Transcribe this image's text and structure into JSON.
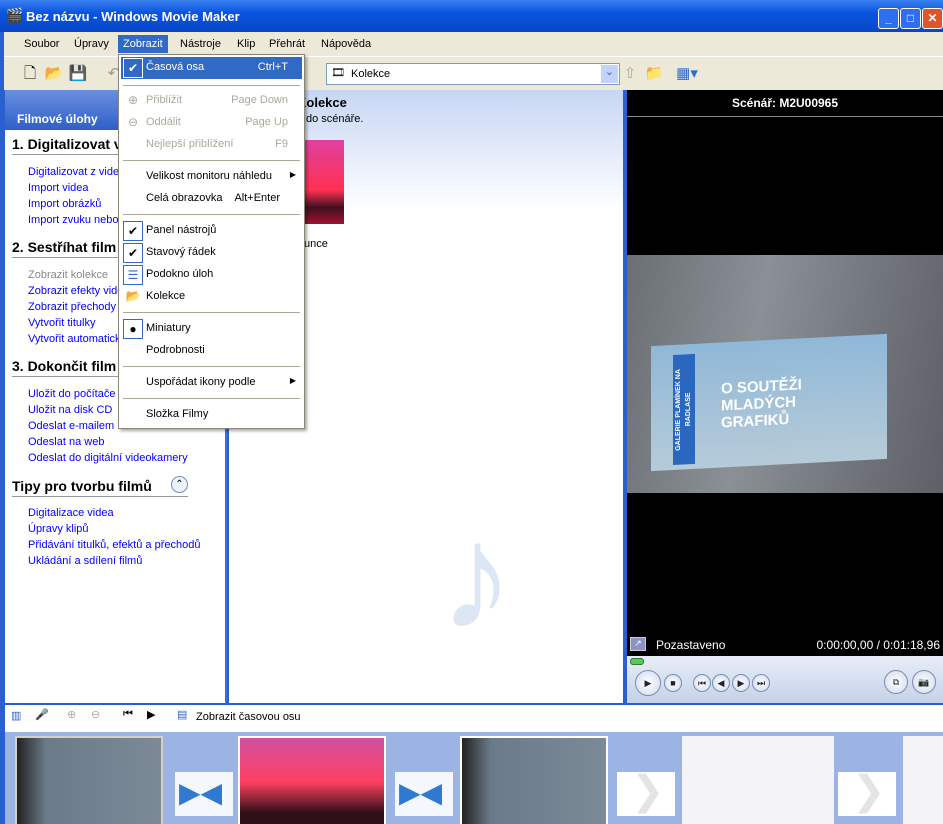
{
  "window": {
    "title": "Bez názvu - Windows Movie Maker",
    "buttons": {
      "minimize": "_",
      "maximize": "□",
      "close": "✕"
    }
  },
  "menubar": [
    "Soubor",
    "Úpravy",
    "Zobrazit",
    "Nástroje",
    "Klip",
    "Přehrát",
    "Nápověda"
  ],
  "toolbar": {
    "collection_combo": "Kolekce"
  },
  "view_menu": {
    "items": [
      {
        "label": "Časová osa",
        "shortcut": "Ctrl+T",
        "checked": true
      },
      {
        "label": "Přiblížit",
        "shortcut": "Page Down",
        "disabled": true
      },
      {
        "label": "Oddálit",
        "shortcut": "Page Up",
        "disabled": true
      },
      {
        "label": "Nejlepší přiblížení",
        "shortcut": "F9",
        "disabled": true
      },
      {
        "label": "Velikost monitoru náhledu",
        "submenu": true
      },
      {
        "label": "Celá obrazovka",
        "shortcut": "Alt+Enter"
      },
      {
        "label": "Panel nástrojů",
        "checked": true
      },
      {
        "label": "Stavový řádek",
        "checked": true
      },
      {
        "label": "Podokno úloh",
        "checked": true
      },
      {
        "label": "Kolekce"
      },
      {
        "label": "Miniatury",
        "selected": true
      },
      {
        "label": "Podrobnosti"
      },
      {
        "label": "Uspořádat ikony podle",
        "submenu": true
      },
      {
        "label": "Složka Filmy"
      }
    ]
  },
  "tasks": {
    "header": "Filmové úlohy",
    "sections": [
      {
        "title": "1. Digitalizovat video",
        "links": [
          "Digitalizovat z videokamery",
          "Import videa",
          "Import obrázků",
          "Import zvuku nebo hudby"
        ]
      },
      {
        "title": "2. Sestříhat film",
        "links": [
          "Zobrazit kolekce",
          "Zobrazit efekty videa",
          "Zobrazit přechody",
          "Vytvořit titulky",
          "Vytvořit automaticky film"
        ]
      },
      {
        "title": "3. Dokončit film",
        "links": [
          "Uložit do počítače",
          "Uložit na disk CD",
          "Odeslat e-mailem",
          "Odeslat na web",
          "Odeslat do digitální videokamery"
        ]
      },
      {
        "title": "Tipy pro tvorbu filmů",
        "links": [
          "Digitalizace videa",
          "Úpravy klipů",
          "Přidávání titulků, efektů a přechodů",
          "Ukládání a sdílení filmů"
        ]
      }
    ]
  },
  "collection": {
    "title": "Kolekce",
    "subtitle": "do scénáře.",
    "clip_label": "unce"
  },
  "preview": {
    "title": "Scénář: M2U00965",
    "status": "Pozastaveno",
    "time": "0:00:00,00 / 0:01:18,96",
    "progress": 0,
    "sign_text": "O SOUTĚŽI MLADÝCH GRAFIKŮ",
    "sign_side": "GALERIE PLAMÍNEK NA RADLASE"
  },
  "storyboard": {
    "show_timeline": "Zobrazit časovou osu"
  }
}
